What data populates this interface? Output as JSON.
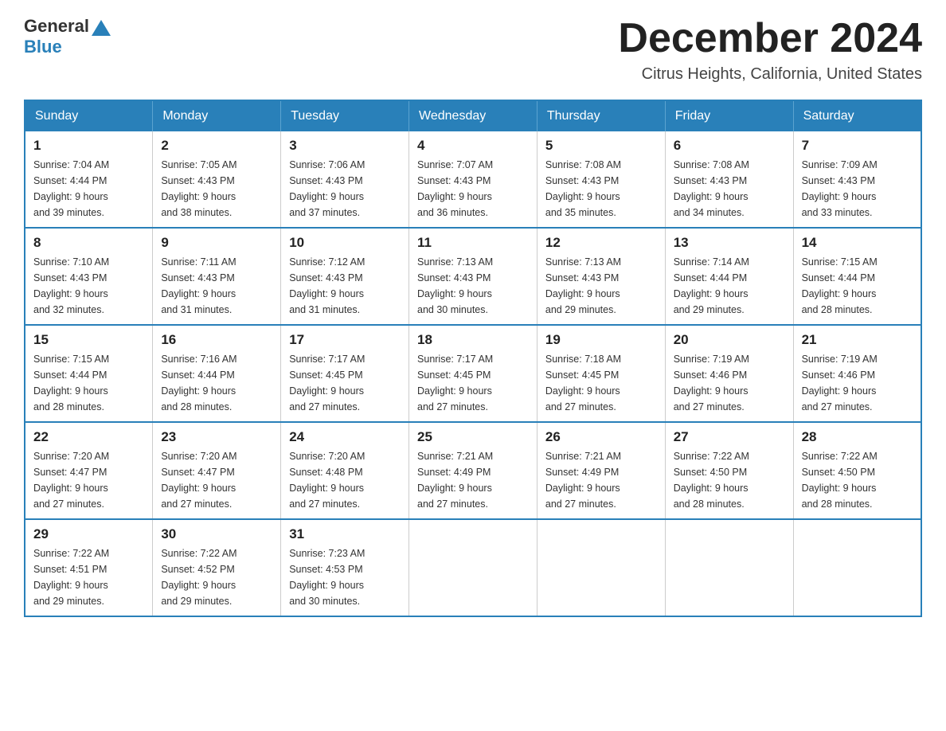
{
  "header": {
    "logo_general": "General",
    "logo_blue": "Blue",
    "month": "December 2024",
    "location": "Citrus Heights, California, United States"
  },
  "days_of_week": [
    "Sunday",
    "Monday",
    "Tuesday",
    "Wednesday",
    "Thursday",
    "Friday",
    "Saturday"
  ],
  "weeks": [
    [
      {
        "day": "1",
        "sunrise": "7:04 AM",
        "sunset": "4:44 PM",
        "daylight": "9 hours and 39 minutes."
      },
      {
        "day": "2",
        "sunrise": "7:05 AM",
        "sunset": "4:43 PM",
        "daylight": "9 hours and 38 minutes."
      },
      {
        "day": "3",
        "sunrise": "7:06 AM",
        "sunset": "4:43 PM",
        "daylight": "9 hours and 37 minutes."
      },
      {
        "day": "4",
        "sunrise": "7:07 AM",
        "sunset": "4:43 PM",
        "daylight": "9 hours and 36 minutes."
      },
      {
        "day": "5",
        "sunrise": "7:08 AM",
        "sunset": "4:43 PM",
        "daylight": "9 hours and 35 minutes."
      },
      {
        "day": "6",
        "sunrise": "7:08 AM",
        "sunset": "4:43 PM",
        "daylight": "9 hours and 34 minutes."
      },
      {
        "day": "7",
        "sunrise": "7:09 AM",
        "sunset": "4:43 PM",
        "daylight": "9 hours and 33 minutes."
      }
    ],
    [
      {
        "day": "8",
        "sunrise": "7:10 AM",
        "sunset": "4:43 PM",
        "daylight": "9 hours and 32 minutes."
      },
      {
        "day": "9",
        "sunrise": "7:11 AM",
        "sunset": "4:43 PM",
        "daylight": "9 hours and 31 minutes."
      },
      {
        "day": "10",
        "sunrise": "7:12 AM",
        "sunset": "4:43 PM",
        "daylight": "9 hours and 31 minutes."
      },
      {
        "day": "11",
        "sunrise": "7:13 AM",
        "sunset": "4:43 PM",
        "daylight": "9 hours and 30 minutes."
      },
      {
        "day": "12",
        "sunrise": "7:13 AM",
        "sunset": "4:43 PM",
        "daylight": "9 hours and 29 minutes."
      },
      {
        "day": "13",
        "sunrise": "7:14 AM",
        "sunset": "4:44 PM",
        "daylight": "9 hours and 29 minutes."
      },
      {
        "day": "14",
        "sunrise": "7:15 AM",
        "sunset": "4:44 PM",
        "daylight": "9 hours and 28 minutes."
      }
    ],
    [
      {
        "day": "15",
        "sunrise": "7:15 AM",
        "sunset": "4:44 PM",
        "daylight": "9 hours and 28 minutes."
      },
      {
        "day": "16",
        "sunrise": "7:16 AM",
        "sunset": "4:44 PM",
        "daylight": "9 hours and 28 minutes."
      },
      {
        "day": "17",
        "sunrise": "7:17 AM",
        "sunset": "4:45 PM",
        "daylight": "9 hours and 27 minutes."
      },
      {
        "day": "18",
        "sunrise": "7:17 AM",
        "sunset": "4:45 PM",
        "daylight": "9 hours and 27 minutes."
      },
      {
        "day": "19",
        "sunrise": "7:18 AM",
        "sunset": "4:45 PM",
        "daylight": "9 hours and 27 minutes."
      },
      {
        "day": "20",
        "sunrise": "7:19 AM",
        "sunset": "4:46 PM",
        "daylight": "9 hours and 27 minutes."
      },
      {
        "day": "21",
        "sunrise": "7:19 AM",
        "sunset": "4:46 PM",
        "daylight": "9 hours and 27 minutes."
      }
    ],
    [
      {
        "day": "22",
        "sunrise": "7:20 AM",
        "sunset": "4:47 PM",
        "daylight": "9 hours and 27 minutes."
      },
      {
        "day": "23",
        "sunrise": "7:20 AM",
        "sunset": "4:47 PM",
        "daylight": "9 hours and 27 minutes."
      },
      {
        "day": "24",
        "sunrise": "7:20 AM",
        "sunset": "4:48 PM",
        "daylight": "9 hours and 27 minutes."
      },
      {
        "day": "25",
        "sunrise": "7:21 AM",
        "sunset": "4:49 PM",
        "daylight": "9 hours and 27 minutes."
      },
      {
        "day": "26",
        "sunrise": "7:21 AM",
        "sunset": "4:49 PM",
        "daylight": "9 hours and 27 minutes."
      },
      {
        "day": "27",
        "sunrise": "7:22 AM",
        "sunset": "4:50 PM",
        "daylight": "9 hours and 28 minutes."
      },
      {
        "day": "28",
        "sunrise": "7:22 AM",
        "sunset": "4:50 PM",
        "daylight": "9 hours and 28 minutes."
      }
    ],
    [
      {
        "day": "29",
        "sunrise": "7:22 AM",
        "sunset": "4:51 PM",
        "daylight": "9 hours and 29 minutes."
      },
      {
        "day": "30",
        "sunrise": "7:22 AM",
        "sunset": "4:52 PM",
        "daylight": "9 hours and 29 minutes."
      },
      {
        "day": "31",
        "sunrise": "7:23 AM",
        "sunset": "4:53 PM",
        "daylight": "9 hours and 30 minutes."
      },
      null,
      null,
      null,
      null
    ]
  ],
  "labels": {
    "sunrise": "Sunrise: ",
    "sunset": "Sunset: ",
    "daylight": "Daylight: "
  }
}
